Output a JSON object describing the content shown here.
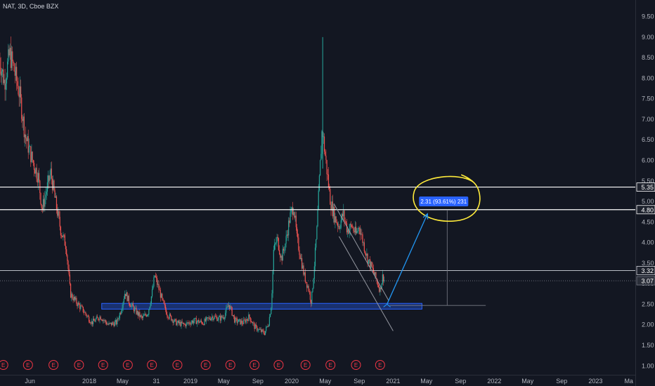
{
  "chart_data": {
    "type": "candlestick",
    "title": "NAT, 3D, Cboe BZX",
    "symbol": "NAT",
    "interval": "3D",
    "exchange": "Cboe BZX",
    "ylim": [
      0.95,
      9.6
    ],
    "y_ticks": [
      "1.00",
      "1.50",
      "2.00",
      "2.50",
      "3.00",
      "3.50",
      "4.00",
      "4.50",
      "5.00",
      "5.50",
      "6.00",
      "6.50",
      "7.00",
      "7.50",
      "8.00",
      "8.50",
      "9.00",
      "9.50"
    ],
    "x_axis_labels": [
      {
        "label": "Jun",
        "date": "2017-06-01"
      },
      {
        "label": "2018",
        "date": "2018-01-01"
      },
      {
        "label": "May",
        "date": "2018-05-01"
      },
      {
        "label": "31",
        "date": "2018-08-31"
      },
      {
        "label": "2019",
        "date": "2019-01-01"
      },
      {
        "label": "May",
        "date": "2019-05-01"
      },
      {
        "label": "Sep",
        "date": "2019-09-01"
      },
      {
        "label": "2020",
        "date": "2020-01-01"
      },
      {
        "label": "May",
        "date": "2020-05-01"
      },
      {
        "label": "Sep",
        "date": "2020-09-01"
      },
      {
        "label": "2021",
        "date": "2021-01-01"
      },
      {
        "label": "May",
        "date": "2021-05-01"
      },
      {
        "label": "Sep",
        "date": "2021-09-01"
      },
      {
        "label": "2022",
        "date": "2022-01-01"
      },
      {
        "label": "May",
        "date": "2022-05-01"
      },
      {
        "label": "Sep",
        "date": "2022-09-01"
      },
      {
        "label": "2023",
        "date": "2023-01-01"
      },
      {
        "label": "Ma",
        "date": "2023-05-01"
      }
    ],
    "price_path": [
      [
        "2017-02-10",
        8.5
      ],
      [
        "2017-03-01",
        7.9
      ],
      [
        "2017-03-20",
        8.6
      ],
      [
        "2017-04-05",
        8.2
      ],
      [
        "2017-04-25",
        7.6
      ],
      [
        "2017-05-15",
        6.6
      ],
      [
        "2017-06-01",
        6.2
      ],
      [
        "2017-06-15",
        5.9
      ],
      [
        "2017-07-01",
        5.6
      ],
      [
        "2017-07-15",
        4.8
      ],
      [
        "2017-08-01",
        5.3
      ],
      [
        "2017-08-15",
        5.7
      ],
      [
        "2017-09-01",
        5.0
      ],
      [
        "2017-09-20",
        4.3
      ],
      [
        "2017-10-10",
        3.9
      ],
      [
        "2017-10-25",
        2.75
      ],
      [
        "2017-11-15",
        2.55
      ],
      [
        "2017-12-10",
        2.35
      ],
      [
        "2018-01-10",
        2.05
      ],
      [
        "2018-02-10",
        2.2
      ],
      [
        "2018-03-10",
        2.0
      ],
      [
        "2018-04-10",
        2.05
      ],
      [
        "2018-04-25",
        2.35
      ],
      [
        "2018-05-10",
        2.8
      ],
      [
        "2018-05-25",
        2.55
      ],
      [
        "2018-06-15",
        2.35
      ],
      [
        "2018-07-10",
        2.15
      ],
      [
        "2018-08-01",
        2.3
      ],
      [
        "2018-08-15",
        2.75
      ],
      [
        "2018-08-25",
        3.2
      ],
      [
        "2018-09-10",
        2.85
      ],
      [
        "2018-09-25",
        2.5
      ],
      [
        "2018-10-10",
        2.25
      ],
      [
        "2018-11-10",
        2.05
      ],
      [
        "2018-12-10",
        2.0
      ],
      [
        "2019-01-15",
        2.1
      ],
      [
        "2019-02-15",
        2.05
      ],
      [
        "2019-03-20",
        2.2
      ],
      [
        "2019-04-15",
        2.15
      ],
      [
        "2019-05-01",
        2.2
      ],
      [
        "2019-05-20",
        2.5
      ],
      [
        "2019-06-10",
        2.1
      ],
      [
        "2019-07-10",
        2.05
      ],
      [
        "2019-08-01",
        2.2
      ],
      [
        "2019-08-20",
        1.95
      ],
      [
        "2019-09-10",
        1.85
      ],
      [
        "2019-09-25",
        1.8
      ],
      [
        "2019-10-10",
        2.05
      ],
      [
        "2019-10-20",
        2.5
      ],
      [
        "2019-10-28",
        3.8
      ],
      [
        "2019-11-10",
        4.1
      ],
      [
        "2019-11-25",
        3.6
      ],
      [
        "2019-12-10",
        4.0
      ],
      [
        "2019-12-25",
        4.6
      ],
      [
        "2020-01-08",
        4.9
      ],
      [
        "2020-01-20",
        4.1
      ],
      [
        "2020-02-01",
        3.7
      ],
      [
        "2020-02-15",
        3.2
      ],
      [
        "2020-03-01",
        2.9
      ],
      [
        "2020-03-12",
        2.55
      ],
      [
        "2020-03-20",
        3.2
      ],
      [
        "2020-04-01",
        4.3
      ],
      [
        "2020-04-10",
        5.5
      ],
      [
        "2020-04-20",
        6.8
      ],
      [
        "2020-04-28",
        6.3
      ],
      [
        "2020-05-08",
        5.7
      ],
      [
        "2020-05-20",
        5.0
      ],
      [
        "2020-06-05",
        4.6
      ],
      [
        "2020-06-20",
        4.4
      ],
      [
        "2020-07-05",
        4.7
      ],
      [
        "2020-07-20",
        4.3
      ],
      [
        "2020-08-05",
        4.4
      ],
      [
        "2020-08-20",
        4.2
      ],
      [
        "2020-09-01",
        4.4
      ],
      [
        "2020-09-15",
        4.0
      ],
      [
        "2020-10-01",
        3.6
      ],
      [
        "2020-10-15",
        3.4
      ],
      [
        "2020-11-01",
        3.1
      ],
      [
        "2020-11-15",
        2.85
      ],
      [
        "2020-11-25",
        3.2
      ],
      [
        "2020-12-01",
        3.07
      ]
    ],
    "extreme_wicks": [
      {
        "date": "2020-04-22",
        "high": 9.0,
        "low": 5.8
      }
    ],
    "horizontal_levels": [
      {
        "value": 5.35,
        "label": "5.35",
        "color": "#ffffff",
        "style": "solid"
      },
      {
        "value": 4.8,
        "label": "4.80",
        "color": "#ffffff",
        "style": "solid"
      },
      {
        "value": 3.32,
        "label": "3.32",
        "color": "#d1d4dc",
        "style": "solid"
      },
      {
        "value": 3.07,
        "label": "3.07",
        "color": "#787b86",
        "style": "dotted"
      }
    ],
    "support_zone": {
      "from": "2018-02-15",
      "to": "2021-04-15",
      "low": 2.38,
      "high": 2.52,
      "color": "#2962ff"
    },
    "channel_lines": [
      {
        "from": [
          "2020-06-01",
          4.95
        ],
        "to": [
          "2020-12-15",
          2.6
        ]
      },
      {
        "from": [
          "2020-06-20",
          4.15
        ],
        "to": [
          "2021-01-01",
          1.85
        ]
      }
    ],
    "projection_arrow": {
      "from": [
        "2020-12-10",
        2.5
      ],
      "to": [
        "2021-05-05",
        4.7
      ],
      "color": "#2196f3"
    },
    "measure": {
      "label": "2.31 (93.61%) 231",
      "anchor_date": "2021-07-15",
      "from_value": 2.47,
      "to_value": 4.78,
      "color": "#2962ff"
    },
    "highlight_circle": {
      "center": [
        "2021-07-20",
        5.0
      ],
      "color": "#ffeb3b"
    },
    "earnings_markers": [
      {
        "date": "2017-02-25",
        "label": "E"
      },
      {
        "date": "2017-05-25",
        "label": "E"
      },
      {
        "date": "2017-08-25",
        "label": "E"
      },
      {
        "date": "2017-11-25",
        "label": "E"
      },
      {
        "date": "2018-02-20",
        "label": "E"
      },
      {
        "date": "2018-05-20",
        "label": "E"
      },
      {
        "date": "2018-08-15",
        "label": "E"
      },
      {
        "date": "2018-11-15",
        "label": "E"
      },
      {
        "date": "2019-02-25",
        "label": "E"
      },
      {
        "date": "2019-05-25",
        "label": "E"
      },
      {
        "date": "2019-08-20",
        "label": "E"
      },
      {
        "date": "2019-11-15",
        "label": "E"
      },
      {
        "date": "2020-02-20",
        "label": "E"
      },
      {
        "date": "2020-05-20",
        "label": "E"
      },
      {
        "date": "2020-08-20",
        "label": "E"
      },
      {
        "date": "2020-11-15",
        "label": "E"
      }
    ],
    "colors": {
      "background": "#131722",
      "up": "#26a69a",
      "down": "#ef5350",
      "axis_text": "#b2b5be",
      "earnings": "#f23645"
    }
  }
}
